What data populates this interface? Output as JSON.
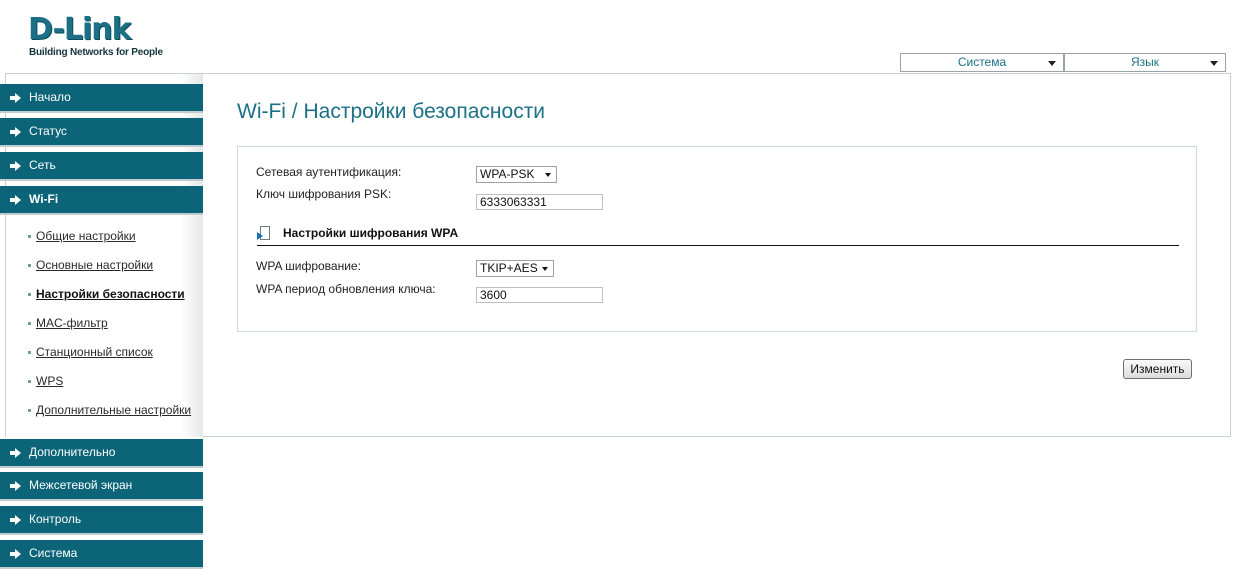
{
  "logo": {
    "brand": "D-Link",
    "tagline": "Building Networks for People"
  },
  "top_menu": {
    "system": "Система",
    "language": "Язык"
  },
  "nav": {
    "items": [
      {
        "label": "Начало"
      },
      {
        "label": "Статус"
      },
      {
        "label": "Сеть"
      },
      {
        "label": "Wi-Fi"
      },
      {
        "label": "Дополнительно"
      },
      {
        "label": "Межсетевой экран"
      },
      {
        "label": "Контроль"
      },
      {
        "label": "Система"
      }
    ],
    "wifi_sub": [
      {
        "label": "Общие настройки"
      },
      {
        "label": "Основные настройки"
      },
      {
        "label": "Настройки безопасности"
      },
      {
        "label": "MAC-фильтр"
      },
      {
        "label": "Станционный список"
      },
      {
        "label": "WPS"
      },
      {
        "label": "Дополнительные настройки"
      }
    ]
  },
  "page": {
    "title": "Wi-Fi / Настройки безопасности",
    "auth_label": "Сетевая аутентификация:",
    "auth_value": "WPA-PSK",
    "psk_label": "Ключ шифрования PSK:",
    "psk_value": "6333063331",
    "section_title": "Настройки шифрования WPA",
    "wpa_enc_label": "WPA шифрование:",
    "wpa_enc_value": "TKIP+AES",
    "rekey_label": "WPA период обновления ключа:",
    "rekey_value": "3600",
    "apply_button": "Изменить"
  },
  "colors": {
    "accent": "#0b6478",
    "title": "#1b7085"
  }
}
